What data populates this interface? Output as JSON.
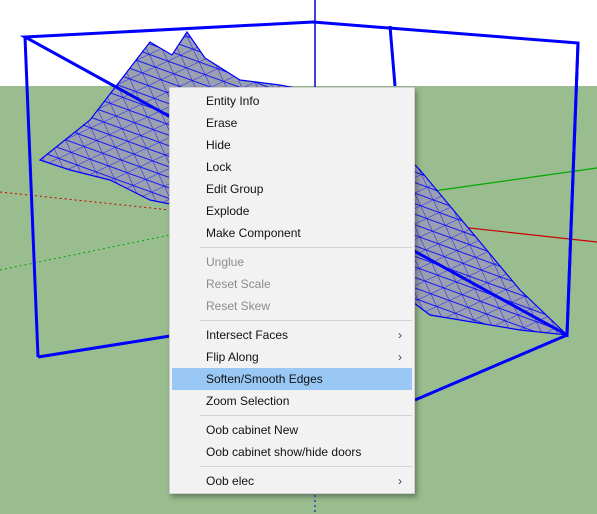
{
  "colors": {
    "sky": "#ffffff",
    "ground": "#99bd8f",
    "selection_edges": "#0000ff",
    "terrain_face": "#9aa0b0",
    "menu_background": "#f2f2f2",
    "menu_highlight": "#9ac8f5",
    "axis_blue": "#0000cc",
    "axis_red": "#cc0000",
    "axis_green": "#00aa00"
  },
  "viewport": {
    "scene": "sketchup-terrain-group-selected"
  },
  "context_menu": {
    "groups": [
      {
        "items": [
          {
            "label": "Entity Info",
            "enabled": true
          },
          {
            "label": "Erase",
            "enabled": true
          },
          {
            "label": "Hide",
            "enabled": true
          },
          {
            "label": "Lock",
            "enabled": true
          },
          {
            "label": "Edit Group",
            "enabled": true
          },
          {
            "label": "Explode",
            "enabled": true
          },
          {
            "label": "Make Component",
            "enabled": true
          }
        ]
      },
      {
        "items": [
          {
            "label": "Unglue",
            "enabled": false
          },
          {
            "label": "Reset Scale",
            "enabled": false
          },
          {
            "label": "Reset Skew",
            "enabled": false
          }
        ]
      },
      {
        "items": [
          {
            "label": "Intersect Faces",
            "enabled": true,
            "submenu": true
          },
          {
            "label": "Flip Along",
            "enabled": true,
            "submenu": true
          },
          {
            "label": "Soften/Smooth Edges",
            "enabled": true,
            "highlighted": true
          },
          {
            "label": "Zoom Selection",
            "enabled": true
          }
        ]
      },
      {
        "items": [
          {
            "label": "Oob cabinet New",
            "enabled": true
          },
          {
            "label": "Oob cabinet show/hide doors",
            "enabled": true
          }
        ]
      },
      {
        "items": [
          {
            "label": "Oob elec",
            "enabled": true,
            "submenu": true
          }
        ]
      }
    ],
    "submenu_arrow": "›"
  }
}
